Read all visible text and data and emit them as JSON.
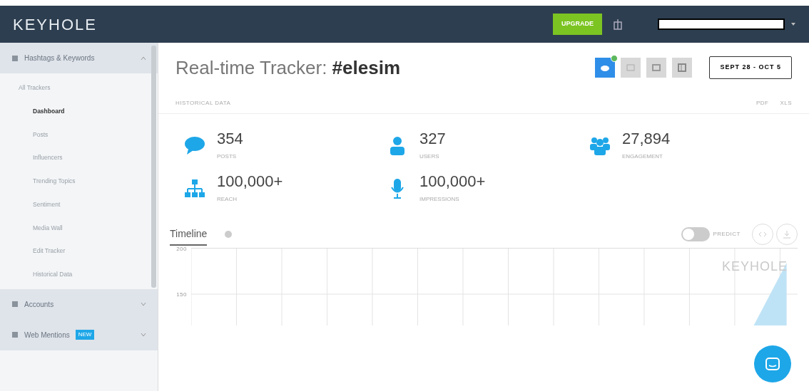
{
  "header": {
    "logo": "KEYHOLE",
    "upgrade_button": "UPGRADE"
  },
  "sidebar": {
    "sections": [
      {
        "label": "Hashtags & Keywords",
        "expanded": true,
        "children": [
          {
            "label": "All Trackers",
            "kind": "heading",
            "selected": false
          },
          {
            "label": "Dashboard",
            "kind": "link",
            "selected": true
          },
          {
            "label": "Posts",
            "kind": "link",
            "selected": false
          },
          {
            "label": "Influencers",
            "kind": "link",
            "selected": false
          },
          {
            "label": "Trending Topics",
            "kind": "link",
            "selected": false
          },
          {
            "label": "Sentiment",
            "kind": "link",
            "selected": false
          },
          {
            "label": "Media Wall",
            "kind": "link",
            "selected": false
          },
          {
            "label": "Edit Tracker",
            "kind": "link",
            "selected": false
          },
          {
            "label": "Historical Data",
            "kind": "link",
            "selected": false
          }
        ]
      },
      {
        "label": "Accounts",
        "expanded": false
      },
      {
        "label": "Web Mentions",
        "badge": "NEW",
        "expanded": false
      }
    ]
  },
  "title": {
    "prefix": "Real-time Tracker: ",
    "tag": "#elesim"
  },
  "sources": [
    {
      "kind": "twitter",
      "selected": true
    },
    {
      "kind": "grid",
      "selected": false
    },
    {
      "kind": "square",
      "selected": false
    },
    {
      "kind": "panel",
      "selected": false
    }
  ],
  "date_range": "SEPT 28 - OCT 5",
  "historical_link": "HISTORICAL DATA",
  "exports": [
    "PDF",
    "XLS"
  ],
  "stats": [
    {
      "kind": "posts",
      "value": "354",
      "label": "POSTS"
    },
    {
      "kind": "users",
      "value": "327",
      "label": "USERS"
    },
    {
      "kind": "engagement",
      "value": "27,894",
      "label": "ENGAGEMENT"
    },
    {
      "kind": "reach",
      "value": "100,000+",
      "label": "REACH"
    },
    {
      "kind": "impressions",
      "value": "100,000+",
      "label": "IMPRESSIONS"
    }
  ],
  "timeline": {
    "tab": "Timeline",
    "predict": {
      "label": "PREDICT",
      "on": false
    },
    "y_tick_labels": [
      "200",
      "150"
    ],
    "watermark": "KEYHOLE"
  }
}
